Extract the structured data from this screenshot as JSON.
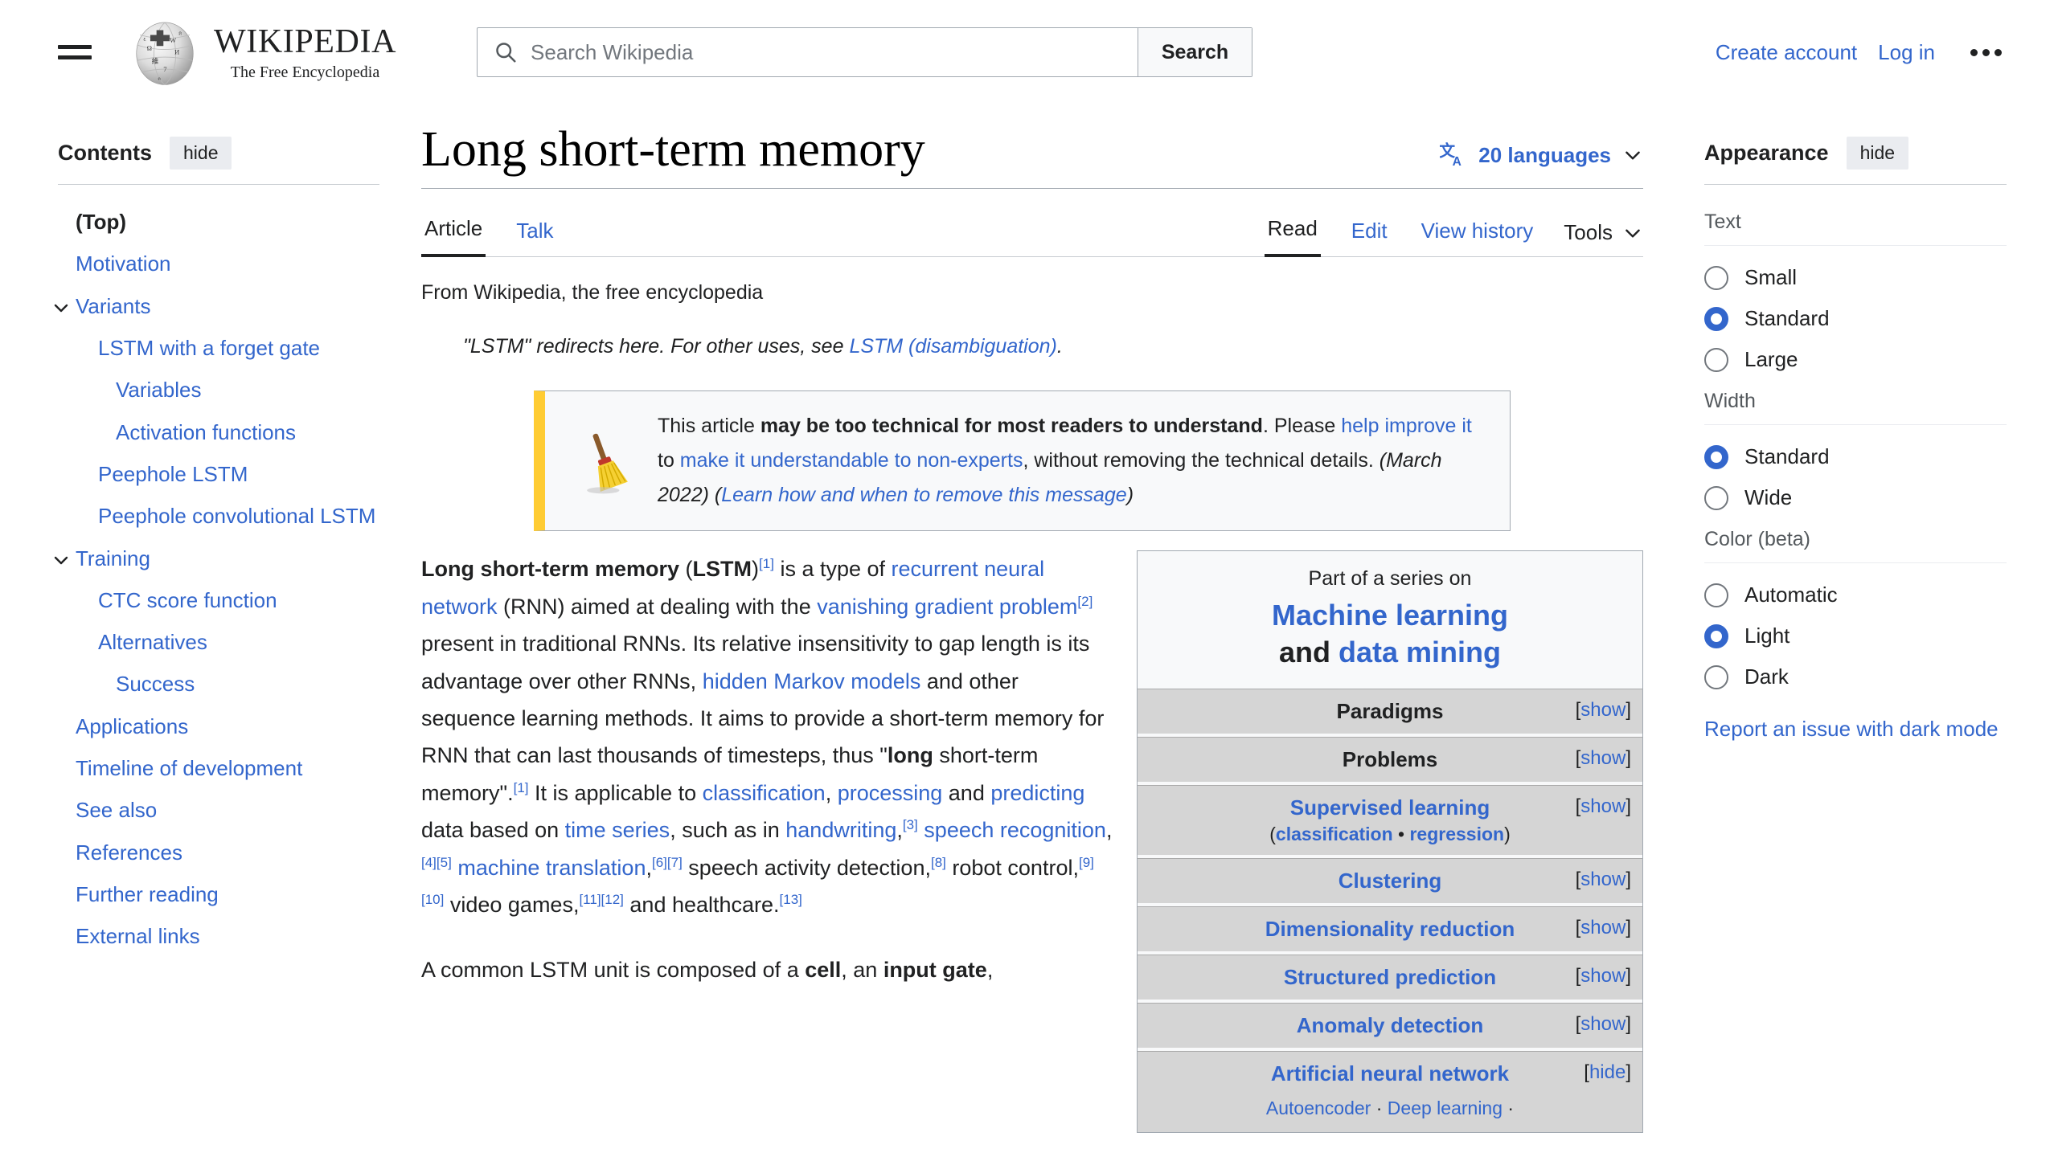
{
  "header": {
    "menu_icon": "hamburger-menu-icon",
    "logo_title": "WIKIPEDIA",
    "logo_tagline": "The Free Encyclopedia",
    "search": {
      "placeholder": "Search Wikipedia",
      "value": "",
      "button_label": "Search",
      "icon": "search-icon"
    },
    "create_account": "Create account",
    "log_in": "Log in",
    "more_icon": "ellipsis-icon"
  },
  "toc": {
    "title": "Contents",
    "hide_label": "hide",
    "items": [
      {
        "label": "(Top)",
        "level": 0,
        "top": true,
        "caret": false
      },
      {
        "label": "Motivation",
        "level": 0,
        "top": false,
        "caret": false
      },
      {
        "label": "Variants",
        "level": 0,
        "top": false,
        "caret": true
      },
      {
        "label": "LSTM with a forget gate",
        "level": 1,
        "top": false,
        "caret": false
      },
      {
        "label": "Variables",
        "level": 2,
        "top": false,
        "caret": false
      },
      {
        "label": "Activation functions",
        "level": 2,
        "top": false,
        "caret": false
      },
      {
        "label": "Peephole LSTM",
        "level": 1,
        "top": false,
        "caret": false
      },
      {
        "label": "Peephole convolutional LSTM",
        "level": 1,
        "top": false,
        "caret": false
      },
      {
        "label": "Training",
        "level": 0,
        "top": false,
        "caret": true
      },
      {
        "label": "CTC score function",
        "level": 1,
        "top": false,
        "caret": false
      },
      {
        "label": "Alternatives",
        "level": 1,
        "top": false,
        "caret": false
      },
      {
        "label": "Success",
        "level": 2,
        "top": false,
        "caret": false
      },
      {
        "label": "Applications",
        "level": 0,
        "top": false,
        "caret": false
      },
      {
        "label": "Timeline of development",
        "level": 0,
        "top": false,
        "caret": false
      },
      {
        "label": "See also",
        "level": 0,
        "top": false,
        "caret": false
      },
      {
        "label": "References",
        "level": 0,
        "top": false,
        "caret": false
      },
      {
        "label": "Further reading",
        "level": 0,
        "top": false,
        "caret": false
      },
      {
        "label": "External links",
        "level": 0,
        "top": false,
        "caret": false
      }
    ]
  },
  "article": {
    "title": "Long short-term memory",
    "languages": {
      "count_label": "20 languages",
      "icon": "language-translate-icon",
      "chevron": "chevron-down-icon"
    },
    "tabs_left": [
      {
        "label": "Article",
        "active": true
      },
      {
        "label": "Talk",
        "active": false
      }
    ],
    "tabs_right": [
      {
        "label": "Read",
        "active": true
      },
      {
        "label": "Edit",
        "active": false
      },
      {
        "label": "View history",
        "active": false
      }
    ],
    "tools_label": "Tools",
    "tagline": "From Wikipedia, the free encyclopedia",
    "hatnote": {
      "pre": "\"LSTM\" redirects here. For other uses, see ",
      "link": "LSTM (disambiguation)",
      "post": "."
    },
    "ambox": {
      "icon": "broom-cleanup-icon",
      "line1_pre": "This article ",
      "line1_bold": "may be too technical for most readers to understand",
      "line1_post": ".",
      "line2_pre": "Please ",
      "line2_link1": "help improve it",
      "line2_mid": " to ",
      "line2_link2": "make it understandable to non-experts",
      "line2_post": ",",
      "line3_pre": "without removing the technical details. ",
      "line3_date": "(March 2022)",
      "line3_learn_open": " (",
      "line3_learn": "Learn how and when to remove this message",
      "line3_learn_close": ")"
    },
    "paragraphs": [
      {
        "id": "p1",
        "parts": [
          {
            "t": "Long short-term memory",
            "s": "b"
          },
          {
            "t": " (",
            "s": "n"
          },
          {
            "t": "LSTM",
            "s": "b"
          },
          {
            "t": ")",
            "s": "n"
          },
          {
            "t": "[1]",
            "s": "ref"
          },
          {
            "t": " is a type of ",
            "s": "n"
          },
          {
            "t": "recurrent neural network",
            "s": "a"
          },
          {
            "t": " (RNN) aimed at dealing with the ",
            "s": "n"
          },
          {
            "t": "vanishing gradient problem",
            "s": "a"
          },
          {
            "t": "[2]",
            "s": "ref"
          },
          {
            "t": " present in traditional RNNs. Its relative insensitivity to gap length is its advantage over other RNNs, ",
            "s": "n"
          },
          {
            "t": "hidden Markov models",
            "s": "a"
          },
          {
            "t": " and other sequence learning methods. It aims to provide a short-term memory for RNN that can last thousands of timesteps, thus \"",
            "s": "n"
          },
          {
            "t": "long",
            "s": "b"
          },
          {
            "t": " short-term memory\".",
            "s": "n"
          },
          {
            "t": "[1]",
            "s": "ref"
          },
          {
            "t": " It is applicable to ",
            "s": "n"
          },
          {
            "t": "classification",
            "s": "a"
          },
          {
            "t": ", ",
            "s": "n"
          },
          {
            "t": "processing",
            "s": "a"
          },
          {
            "t": " and ",
            "s": "n"
          },
          {
            "t": "predicting",
            "s": "a"
          },
          {
            "t": " data based on ",
            "s": "n"
          },
          {
            "t": "time series",
            "s": "a"
          },
          {
            "t": ", such as in ",
            "s": "n"
          },
          {
            "t": "handwriting",
            "s": "a"
          },
          {
            "t": ",",
            "s": "n"
          },
          {
            "t": "[3]",
            "s": "ref"
          },
          {
            "t": " ",
            "s": "n"
          },
          {
            "t": "speech recognition",
            "s": "a"
          },
          {
            "t": ",",
            "s": "n"
          },
          {
            "t": "[4][5]",
            "s": "ref"
          },
          {
            "t": " ",
            "s": "n"
          },
          {
            "t": "machine translation",
            "s": "a"
          },
          {
            "t": ",",
            "s": "n"
          },
          {
            "t": "[6][7]",
            "s": "ref"
          },
          {
            "t": " speech activity detection,",
            "s": "n"
          },
          {
            "t": "[8]",
            "s": "ref"
          },
          {
            "t": " robot control,",
            "s": "n"
          },
          {
            "t": "[9][10]",
            "s": "ref"
          },
          {
            "t": " video games,",
            "s": "n"
          },
          {
            "t": "[11][12]",
            "s": "ref"
          },
          {
            "t": " and healthcare.",
            "s": "n"
          },
          {
            "t": "[13]",
            "s": "ref"
          }
        ]
      },
      {
        "id": "p2",
        "parts": [
          {
            "t": "A common LSTM unit is composed of a ",
            "s": "n"
          },
          {
            "t": "cell",
            "s": "b"
          },
          {
            "t": ", an ",
            "s": "n"
          },
          {
            "t": "input gate",
            "s": "b"
          },
          {
            "t": ",",
            "s": "n"
          }
        ]
      }
    ]
  },
  "infobox": {
    "part_of_label": "Part of a series on",
    "title_line1": "Machine learning",
    "title_and": "and",
    "title_line2": "data mining",
    "rows": [
      {
        "label": "Paradigms",
        "link": false,
        "sub": null,
        "toggle": "[show]"
      },
      {
        "label": "Problems",
        "link": false,
        "sub": null,
        "toggle": "[show]"
      },
      {
        "label": "Supervised learning",
        "link": true,
        "sub": "(classification • regression)",
        "toggle": "[show]"
      },
      {
        "label": "Clustering",
        "link": true,
        "sub": null,
        "toggle": "[show]"
      },
      {
        "label": "Dimensionality reduction",
        "link": true,
        "sub": null,
        "toggle": "[show]"
      },
      {
        "label": "Structured prediction",
        "link": true,
        "sub": null,
        "toggle": "[show]"
      },
      {
        "label": "Anomaly detection",
        "link": true,
        "sub": null,
        "toggle": "[show]"
      },
      {
        "label": "Artificial neural network",
        "link": true,
        "sub": null,
        "toggle": "[hide]",
        "links": "Autoencoder · Deep learning ·"
      }
    ]
  },
  "appearance": {
    "title": "Appearance",
    "hide_label": "hide",
    "groups": [
      {
        "label": "Text",
        "options": [
          {
            "label": "Small",
            "checked": false
          },
          {
            "label": "Standard",
            "checked": true
          },
          {
            "label": "Large",
            "checked": false
          }
        ]
      },
      {
        "label": "Width",
        "options": [
          {
            "label": "Standard",
            "checked": true
          },
          {
            "label": "Wide",
            "checked": false
          }
        ]
      },
      {
        "label": "Color (beta)",
        "options": [
          {
            "label": "Automatic",
            "checked": false
          },
          {
            "label": "Light",
            "checked": true
          },
          {
            "label": "Dark",
            "checked": false
          }
        ]
      }
    ],
    "report_link": "Report an issue with dark mode"
  },
  "colors": {
    "link": "#3366cc",
    "text": "#202122",
    "accent_radio": "#3366cc",
    "ambox_border": "#ffcc33",
    "infobox_bg": "#f8f9fa",
    "infobox_row": "#d5d5d5"
  }
}
